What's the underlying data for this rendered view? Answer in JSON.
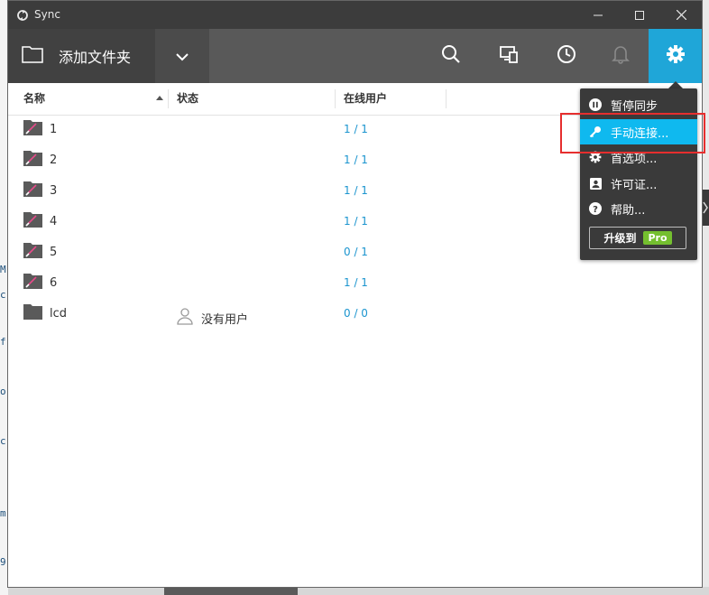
{
  "window": {
    "title": "Sync"
  },
  "toolbar": {
    "add_folder_label": "添加文件夹"
  },
  "columns": {
    "name": "名称",
    "status": "状态",
    "online_users": "在线用户"
  },
  "folders": [
    {
      "name": "1",
      "status": "",
      "peers": "1 / 1"
    },
    {
      "name": "2",
      "status": "",
      "peers": "1 / 1"
    },
    {
      "name": "3",
      "status": "",
      "peers": "1 / 1"
    },
    {
      "name": "4",
      "status": "",
      "peers": "1 / 1"
    },
    {
      "name": "5",
      "status": "",
      "peers": "0 / 1"
    },
    {
      "name": "6",
      "status": "",
      "peers": "1 / 1"
    },
    {
      "name": "lcd",
      "status": "没有用户",
      "peers": "0 / 0"
    }
  ],
  "menu": {
    "pause_sync": "暂停同步",
    "manual_connect": "手动连接...",
    "preferences": "首选项...",
    "license": "许可证...",
    "help": "帮助...",
    "upgrade_label": "升级到",
    "pro_badge": "Pro"
  },
  "background": {
    "fragments": [
      "M",
      "c",
      "f",
      "o.",
      "c",
      "m",
      "9"
    ]
  },
  "colors": {
    "titlebar": "#3c3c3c",
    "toolbar": "#595959",
    "accent": "#1fa6d8",
    "menu_active": "#0fb9ef",
    "peer_text": "#1c95cf",
    "pro_badge": "#74bf2f",
    "highlight_box": "#e62e2e"
  }
}
